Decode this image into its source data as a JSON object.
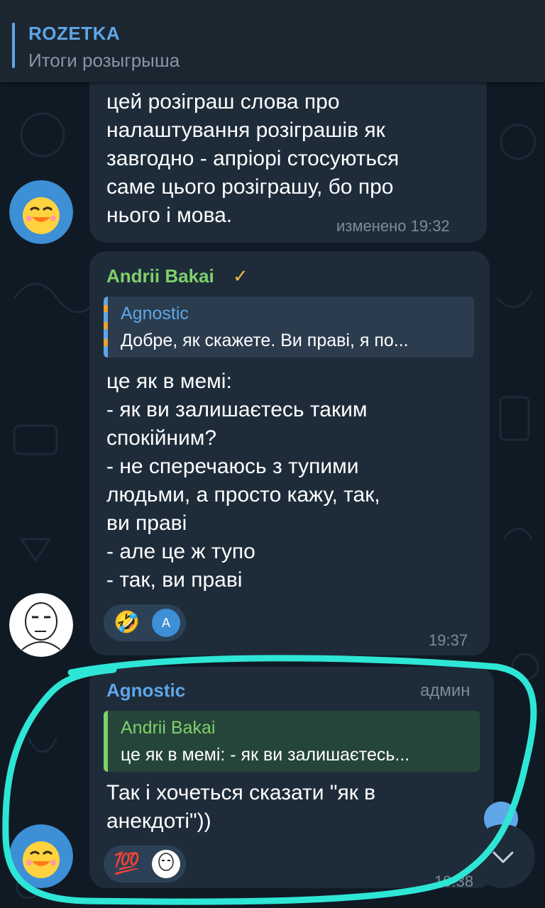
{
  "pinned": {
    "title": "ROZETKA",
    "subtitle": "Итоги розыгрыша"
  },
  "messages": [
    {
      "text": "цей розіграш слова про\nналаштування розіграшів як\nзавгодно - апріорі стосуються\nсаме цього розіграшу, бо про\nнього і мова.",
      "meta": "изменено 19:32"
    },
    {
      "sender": "Andrii Bakai",
      "sender_badge": "✓",
      "reply_name": "Agnostic",
      "reply_text": "Добре, як скажете. Ви праві, я по...",
      "text": "це як в мемі:\n- як ви залишаєтесь таким\nспокійним?\n- не сперечаюсь з тупими\nлюдьми, а просто кажу, так,\nви праві\n- але це ж тупо\n- так, ви праві",
      "reaction_emoji": "🤣",
      "reaction_avatar_letter": "A",
      "time": "19:37"
    },
    {
      "sender": "Agnostic",
      "role": "админ",
      "reply_name": "Andrii Bakai",
      "reply_text": "це як в мемі: - як ви залишаєтесь...",
      "text": "Так і хочеться сказати \"як в\nанекдоті\"))",
      "reaction_emoji": "💯",
      "time": "19:38"
    }
  ],
  "colors": {
    "agnostic_name": "#5fa6e8",
    "andrii_name": "#7fd16b",
    "highlight_stroke": "#2ee6d6"
  },
  "icons": [
    "chick-avatar-icon",
    "meme-face-avatar-icon",
    "chevron-down-icon"
  ]
}
